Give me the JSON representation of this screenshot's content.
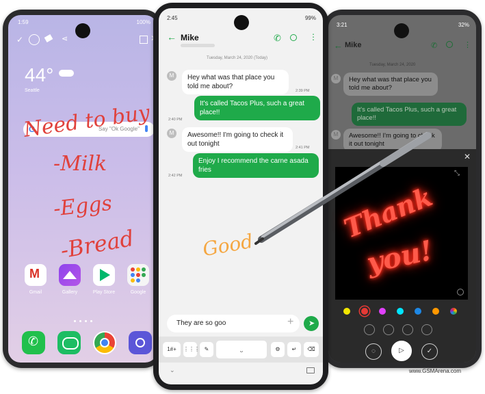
{
  "left_phone": {
    "status_time": "1:59",
    "battery": "100%",
    "weather_temp": "44°",
    "weather_city": "Seattle",
    "search_placeholder": "Say \"Ok Google\"",
    "handwriting": [
      "Need to buy",
      "-Milk",
      "-Eggs",
      "-Bread"
    ],
    "apps": [
      {
        "label": "Gmail",
        "icon": "gmail-icon"
      },
      {
        "label": "Gallery",
        "icon": "gallery-icon"
      },
      {
        "label": "Play Store",
        "icon": "play-store-icon"
      },
      {
        "label": "Google",
        "icon": "google-folder-icon"
      }
    ],
    "dock": [
      "phone-icon",
      "messages-icon",
      "chrome-icon",
      "camera-icon"
    ]
  },
  "middle_phone": {
    "status_time": "2:45",
    "battery": "99%",
    "contact": "Mike",
    "date_header": "Tuesday, March 24, 2020 (Today)",
    "messages": [
      {
        "dir": "in",
        "text": "Hey what was that place you told me about?",
        "time": "2:39 PM"
      },
      {
        "dir": "out",
        "text": "It's called Tacos Plus, such a great place!!",
        "time": "2:40 PM"
      },
      {
        "dir": "in",
        "text": "Awesome!! I'm going to check it out tonight",
        "time": "2:41 PM"
      },
      {
        "dir": "out",
        "text": "Enjoy I recommend the carne asada fries",
        "time": "2:42 PM"
      }
    ],
    "handwriting": "Good",
    "input_value": "They are so goo",
    "keyboard_keys": [
      "1#+",
      "⋮⋮⋮",
      "✎",
      "⎵",
      "⚙",
      "↵",
      "⌫"
    ]
  },
  "right_phone": {
    "status_time": "3:21",
    "battery": "32%",
    "contact": "Mike",
    "date_header": "Tuesday, March 24, 2020",
    "messages": [
      {
        "dir": "in",
        "text": "Hey what was that place you told me about?"
      },
      {
        "dir": "out",
        "text": "It's called Tacos Plus, such a great place!!"
      },
      {
        "dir": "in",
        "text": "Awesome!! I'm going to check it out tonight"
      }
    ],
    "neon_lines": [
      "Thank",
      "you!"
    ],
    "palette": [
      "#f2e600",
      "#e53935",
      "#e040fb",
      "#00e5ff",
      "#1e88e5",
      "#ff9800",
      "#9c27b0"
    ],
    "selected_color": "#e53935"
  },
  "watermark": "www.GSMArena.com"
}
